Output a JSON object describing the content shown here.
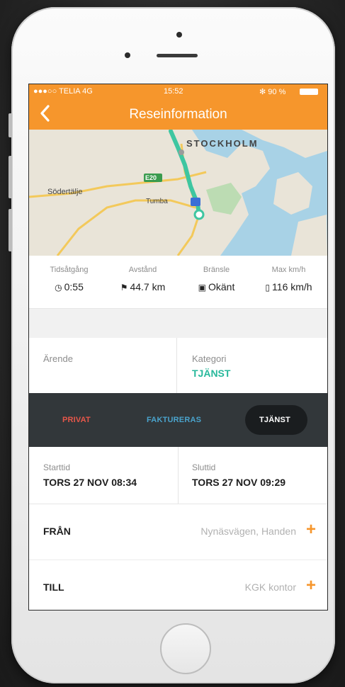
{
  "status": {
    "carrier": "●●●○○ TELIA 4G",
    "time": "15:52",
    "battery": "✻ 90 %"
  },
  "nav": {
    "back_icon": "chevron-left-icon",
    "title": "Reseinformation"
  },
  "map": {
    "city_label": "STOCKHOLM",
    "road_label": "E20",
    "town_left": "Södertälje",
    "town_mid": "Tumba"
  },
  "stats": [
    {
      "label": "Tidsåtgång",
      "icon": "clock-icon",
      "value": "0:55"
    },
    {
      "label": "Avstånd",
      "icon": "flag-icon",
      "value": "44.7 km"
    },
    {
      "label": "Bränsle",
      "icon": "fuel-icon",
      "value": "Okänt"
    },
    {
      "label": "Max km/h",
      "icon": "thermometer-icon",
      "value": "116 km/h"
    }
  ],
  "errand": {
    "label": "Ärende"
  },
  "category": {
    "label": "Kategori",
    "value": "TJÄNST"
  },
  "segment": {
    "options": [
      "PRIVAT",
      "FAKTURERAS",
      "TJÄNST"
    ],
    "selected": "TJÄNST"
  },
  "times": {
    "start": {
      "label": "Starttid",
      "value": "TORS 27 NOV 08:34"
    },
    "end": {
      "label": "Sluttid",
      "value": "TORS 27 NOV 09:29"
    }
  },
  "from": {
    "label": "FRÅN",
    "value": "Nynäsvägen, Handen"
  },
  "to": {
    "label": "TILL",
    "value": "KGK kontor"
  },
  "colors": {
    "accent": "#f6962c",
    "category": "#27b89b",
    "privat": "#e8574a",
    "fakturerras": "#4aa3cc"
  }
}
